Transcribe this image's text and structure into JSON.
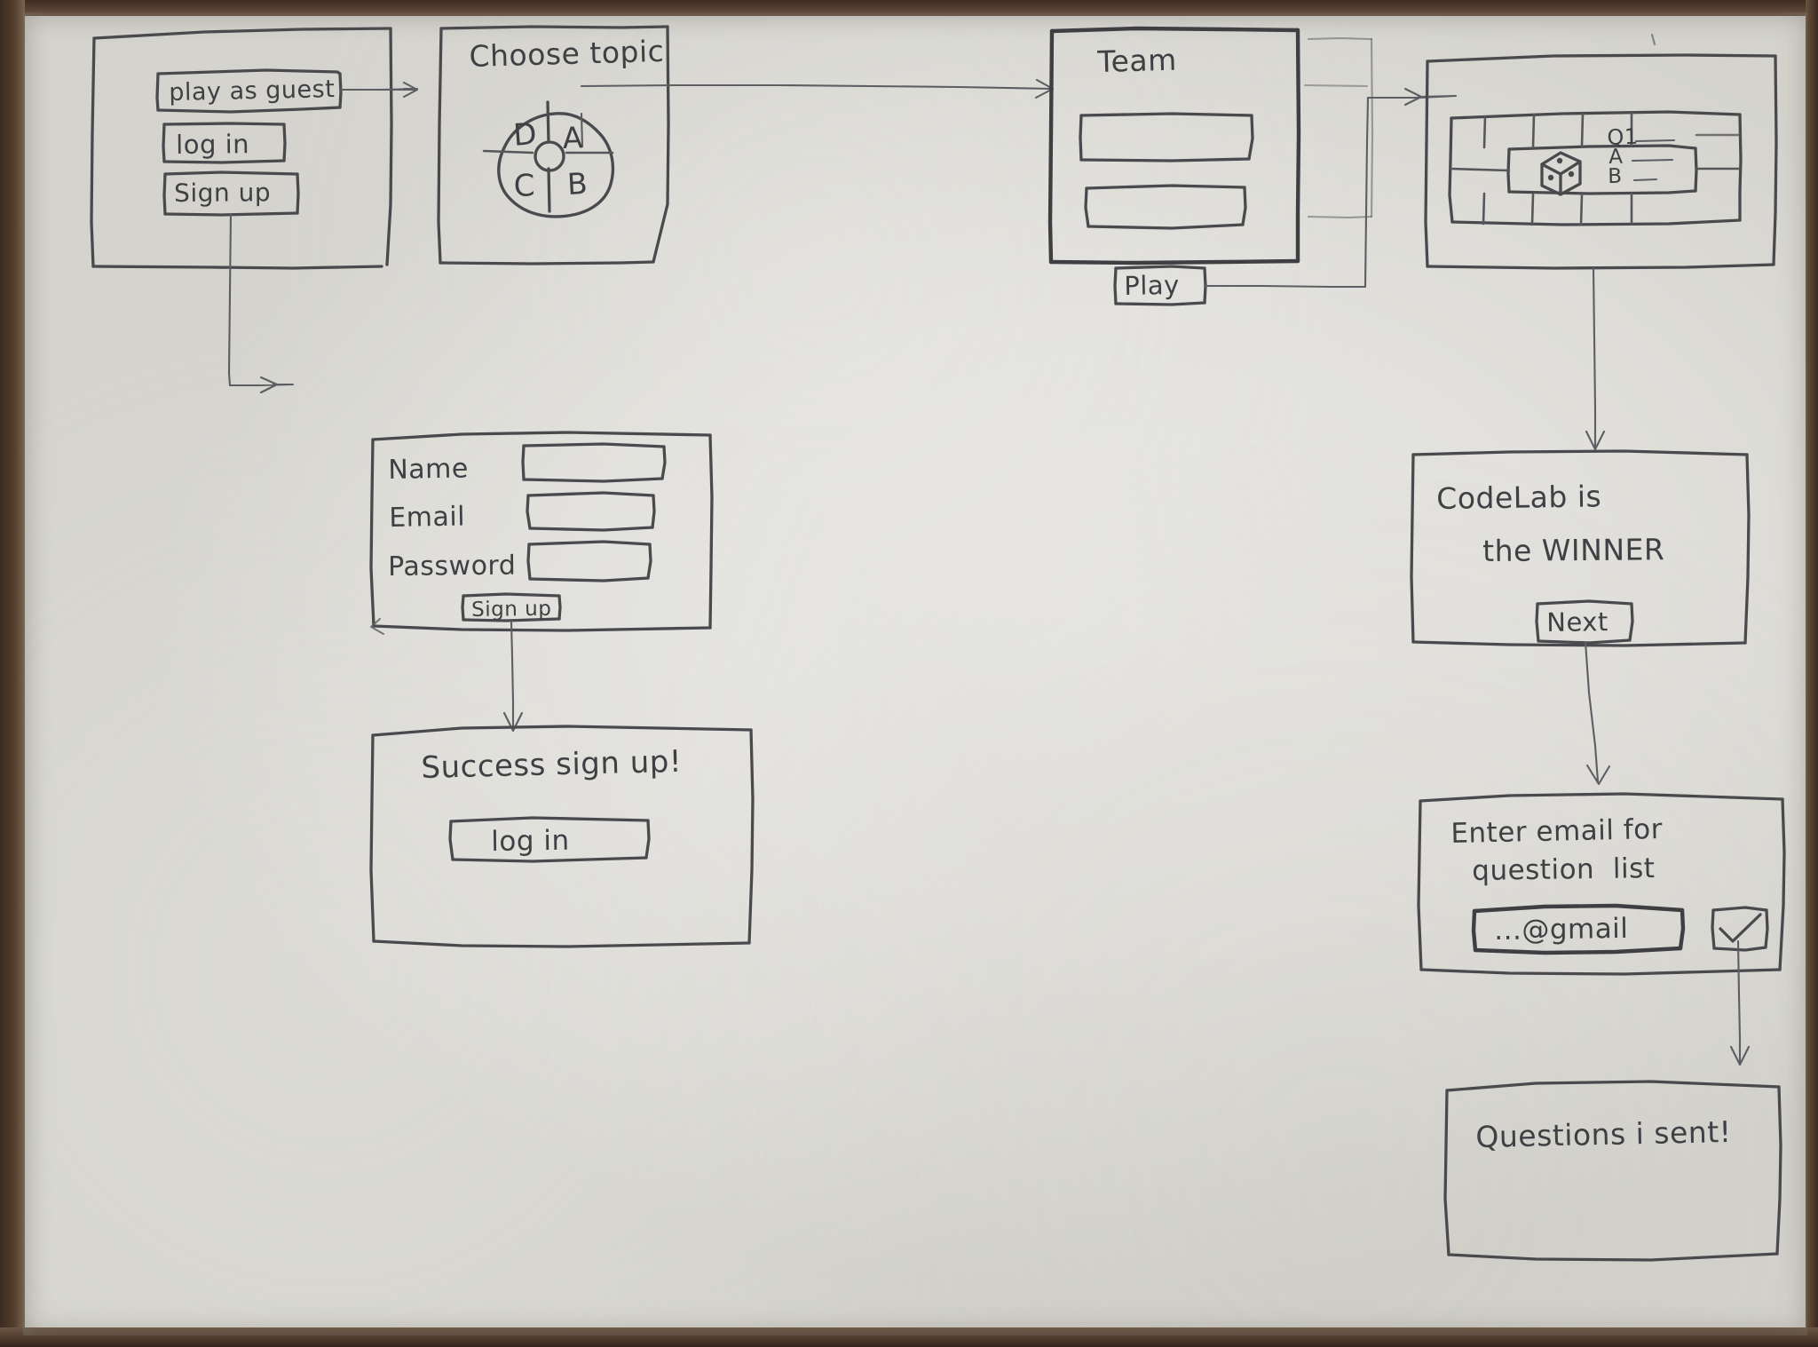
{
  "meta": {
    "title": "Hand-drawn UI wireframe flow for a quiz / board game app",
    "medium": "pencil sketch on white paper",
    "ink_color": "#4a4a4e",
    "paper_color": "#e3e2de",
    "desk_color": "#4a372b"
  },
  "screens": {
    "landing": {
      "name": "landing-screen",
      "buttons": [
        {
          "label": "play as guest"
        },
        {
          "label": "log in"
        },
        {
          "label": "Sign up"
        }
      ]
    },
    "choose_topic": {
      "name": "choose-topic-screen",
      "title": "Choose topic",
      "wheel": {
        "segments": [
          {
            "label": "D",
            "position": "top-left"
          },
          {
            "label": "A",
            "position": "top-right"
          },
          {
            "label": "C",
            "position": "bottom-left"
          },
          {
            "label": "B",
            "position": "bottom-right"
          }
        ],
        "hub": "spinner-hub"
      }
    },
    "team": {
      "name": "team-screen",
      "title": "Team",
      "fields": [
        {
          "value": "",
          "placeholder": ""
        },
        {
          "value": "",
          "placeholder": ""
        }
      ],
      "buttons": [
        {
          "label": "Play"
        }
      ]
    },
    "board": {
      "name": "game-board-screen",
      "dice": "dice-icon",
      "question": {
        "prompt": "Q1",
        "answers": [
          {
            "label": "A"
          },
          {
            "label": "B"
          }
        ]
      },
      "grid": {
        "columns": 5,
        "rows": 4,
        "style": "ring-board"
      }
    },
    "signup_form": {
      "name": "signup-form-screen",
      "fields": [
        {
          "label": "Name",
          "value": ""
        },
        {
          "label": "Email",
          "value": ""
        },
        {
          "label": "Password",
          "value": ""
        }
      ],
      "buttons": [
        {
          "label": "Sign up"
        }
      ]
    },
    "signup_success": {
      "name": "signup-success-screen",
      "message": "Success sign up!",
      "buttons": [
        {
          "label": "log in"
        }
      ]
    },
    "winner": {
      "name": "winner-screen",
      "message_line1": "CodeLab is",
      "message_line2": "the WINNER",
      "buttons": [
        {
          "label": "Next"
        }
      ]
    },
    "email_capture": {
      "name": "email-capture-screen",
      "prompt_line1": "Enter email for",
      "prompt_line2": "question  list",
      "input": {
        "value": "...@gmail",
        "placeholder": "...@gmail"
      },
      "confirm": {
        "label": "✓",
        "icon": "check-icon"
      }
    },
    "questions_sent": {
      "name": "questions-sent-screen",
      "message": "Questions i sent!"
    }
  },
  "flow": {
    "connectors": [
      {
        "from": "landing.play-as-guest",
        "to": "choose-topic-screen",
        "direction": "right"
      },
      {
        "from": "landing.sign-up",
        "to": "signup-form-screen",
        "direction": "down-right"
      },
      {
        "from": "choose-topic-screen",
        "to": "team-screen",
        "direction": "right"
      },
      {
        "from": "team-screen.play",
        "to": "game-board-screen",
        "direction": "right"
      },
      {
        "from": "game-board-screen",
        "to": "winner-screen",
        "direction": "down"
      },
      {
        "from": "signup-form-screen.sign-up",
        "to": "signup-success-screen",
        "direction": "down"
      },
      {
        "from": "winner-screen.next",
        "to": "email-capture-screen",
        "direction": "down"
      },
      {
        "from": "email-capture-screen.confirm",
        "to": "questions-sent-screen",
        "direction": "down"
      }
    ]
  }
}
